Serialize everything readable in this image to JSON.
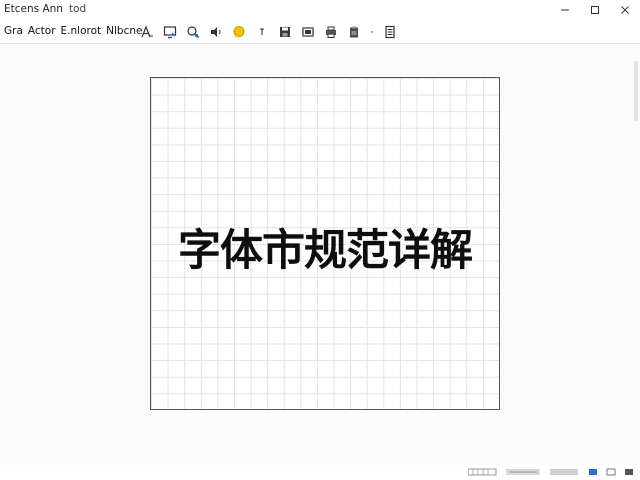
{
  "window": {
    "title": "Etcens Ann",
    "subtitle": "tod"
  },
  "menu": {
    "items": [
      {
        "label": "Gra"
      },
      {
        "label": "Actor"
      },
      {
        "label": "E.nlorot"
      },
      {
        "label": "Nlbcne"
      }
    ]
  },
  "toolbar": {
    "icons": [
      "text-tool-icon",
      "screen-icon",
      "zoom-search-icon",
      "audio-icon",
      "comment-icon",
      "more-small-icon",
      "save-icon",
      "capture-icon",
      "print-icon",
      "clipboard-icon",
      "separator-dot-icon",
      "document-icon"
    ]
  },
  "canvas": {
    "text": "字体市规范详解"
  },
  "statusbar": {
    "icons": [
      "grid-view-icon",
      "page-controls-icon",
      "zoom-controls-icon",
      "fit-icon",
      "layout-icon",
      "fullscreen-icon"
    ]
  }
}
